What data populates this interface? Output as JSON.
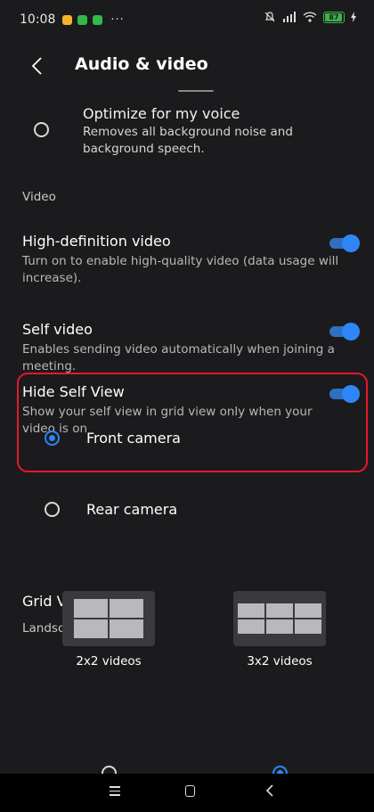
{
  "status_bar": {
    "time": "10:08",
    "more": "···",
    "battery": "87",
    "app_icon_colors": [
      "#f7b32b",
      "#34b84a",
      "#34b84a"
    ]
  },
  "app_bar": {
    "title": "Audio & video",
    "back_icon": "chevron-left-icon"
  },
  "audio_options": {
    "optimize_title": "Optimize for my voice",
    "optimize_desc": "Removes all background noise and background speech.",
    "optimize_selected": false
  },
  "video": {
    "section_title": "Video",
    "settings": [
      {
        "title": "High-definition video",
        "desc": "Turn on to enable high-quality video (data usage will increase).",
        "on": true
      },
      {
        "title": "Self video",
        "desc": "Enables sending video automatically when joining a meeting.",
        "on": true
      },
      {
        "title": "Hide Self View",
        "desc": "Show your self view in grid view only when your video is on",
        "on": true
      }
    ],
    "camera_options": [
      {
        "label": "Front camera",
        "selected": true
      },
      {
        "label": "Rear camera",
        "selected": false
      }
    ]
  },
  "grid_layout": {
    "title": "Grid View Layout",
    "orientation": "Landscape",
    "options": [
      {
        "label": "2x2 videos",
        "selected": false
      },
      {
        "label": "3x2 videos",
        "selected": true
      }
    ]
  },
  "nav_bar": {
    "icons": [
      "menu-icon",
      "home-icon",
      "back-icon"
    ]
  },
  "colors": {
    "background": "#1b1b1d",
    "accent": "#2f86f6",
    "highlight": "#e8172d"
  }
}
